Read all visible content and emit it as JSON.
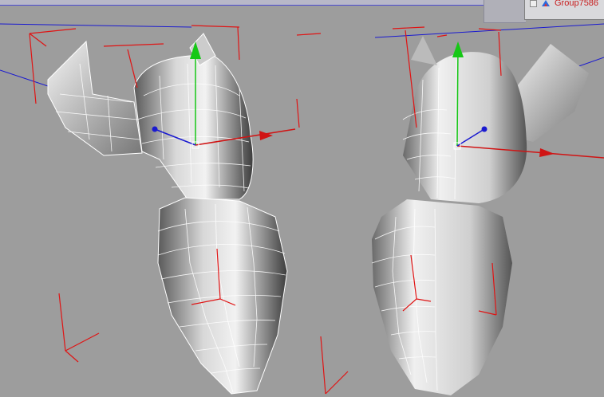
{
  "outliner": {
    "group_label": "Group7586",
    "group_icon": "group-icon"
  },
  "viewport": {
    "name": "3d-perspective-viewport",
    "background": "#9d9d9d",
    "gizmo_colors": {
      "x": "#d01414",
      "y": "#16c816",
      "z": "#1a1ad0"
    },
    "wire_color": "#ffffff",
    "marker_color": "#e01414"
  }
}
